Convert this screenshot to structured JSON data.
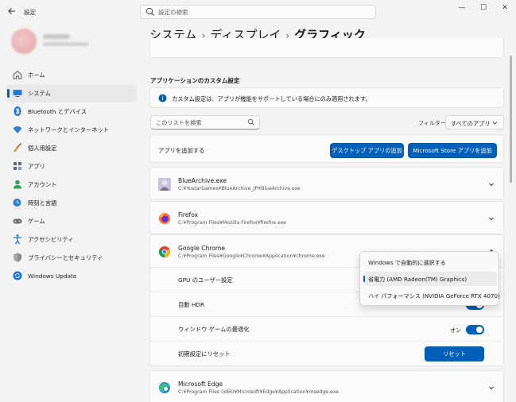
{
  "window": {
    "title": "設定",
    "search_placeholder": "設定の検索",
    "minimize_glyph": "—",
    "maximize_glyph": "☐",
    "close_glyph": "✕"
  },
  "sidebar": {
    "items": [
      {
        "label": "ホーム",
        "icon": "home-icon"
      },
      {
        "label": "システム",
        "icon": "system-icon",
        "active": true
      },
      {
        "label": "Bluetooth とデバイス",
        "icon": "bluetooth-icon"
      },
      {
        "label": "ネットワークとインターネット",
        "icon": "wifi-icon"
      },
      {
        "label": "個人用設定",
        "icon": "brush-icon"
      },
      {
        "label": "アプリ",
        "icon": "apps-icon"
      },
      {
        "label": "アカウント",
        "icon": "account-icon"
      },
      {
        "label": "時刻と言語",
        "icon": "clock-globe-icon"
      },
      {
        "label": "ゲーム",
        "icon": "gamepad-icon"
      },
      {
        "label": "アクセシビリティ",
        "icon": "accessibility-icon"
      },
      {
        "label": "プライバシーとセキュリティ",
        "icon": "shield-icon"
      },
      {
        "label": "Windows Update",
        "icon": "windows-update-icon"
      }
    ]
  },
  "breadcrumb": {
    "level1": "システム",
    "level2": "ディスプレイ",
    "current": "グラフィック",
    "separator": "›"
  },
  "custom": {
    "section_title": "アプリケーションのカスタム設定",
    "info_text": "カスタム設定は、アプリが機能をサポートしている場合にのみ適用されます。",
    "list_search_placeholder": "このリストを検索",
    "filter_label": "フィルター:",
    "filter_value": "すべてのアプリ",
    "add_app_label": "アプリを追加する",
    "add_desktop_button": "デスクトップ アプリの追加",
    "add_store_button": "Microsoft Store アプリを追加"
  },
  "apps": [
    {
      "name": "BlueArchive.exe",
      "path": "C:¥YostarGames¥BlueArchive_JP¥BlueArchive.exe",
      "icon": "bluearchive-icon"
    },
    {
      "name": "Firefox",
      "path": "C:¥Program Files¥Mozilla Firefox¥firefox.exe",
      "icon": "firefox-icon"
    },
    {
      "name": "Google Chrome",
      "path": "C:¥Program Files¥Google¥Chrome¥Application¥chrome.exe",
      "icon": "chrome-icon"
    },
    {
      "name": "Microsoft Edge",
      "path": "C:¥Program Files (x86)¥Microsoft¥Edge¥Application¥msedge.exe",
      "icon": "edge-icon"
    }
  ],
  "chrome_settings": {
    "gpu_label": "GPU のユーザー設定",
    "hdr_label": "自動 HDR",
    "window_game_label": "ウィンドウ ゲームの最適化",
    "window_game_state": "オン",
    "reset_label": "初期設定にリセット",
    "reset_button": "リセット"
  },
  "gpu_dropdown": {
    "options": [
      "Windows で自動的に選択する",
      "省電力 (AMD Radeon(TM) Graphics)",
      "ハイ パフォーマンス (NVIDIA GeForce RTX 4070)"
    ],
    "selected_index": 1
  },
  "colors": {
    "accent": "#005fb8",
    "background": "#f3f3f3",
    "card": "#fbfbfb"
  }
}
